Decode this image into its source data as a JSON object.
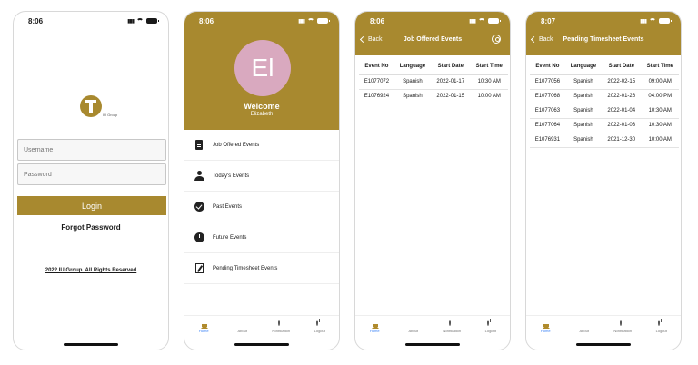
{
  "login_screen": {
    "time": "8:06",
    "logo_sub": "IU Group",
    "username_placeholder": "Username",
    "password_placeholder": "Password",
    "login_label": "Login",
    "forgot_label": "Forgot Password",
    "copyright": "2022 IU Group. All Rights Reserved"
  },
  "home_screen": {
    "time": "8:06",
    "avatar_initials": "El",
    "welcome": "Welcome",
    "user_name": "Elizabeth",
    "menu": [
      {
        "label": "Job Offered Events",
        "icon": "clipboard-icon"
      },
      {
        "label": "Today's Events",
        "icon": "person-icon"
      },
      {
        "label": "Past Events",
        "icon": "check-circle-icon"
      },
      {
        "label": "Future Events",
        "icon": "clock-icon"
      },
      {
        "label": "Pending Timesheet Events",
        "icon": "edit-icon"
      }
    ]
  },
  "tabs": [
    {
      "label": "Home",
      "icon": "home-icon"
    },
    {
      "label": "About",
      "icon": "book-icon"
    },
    {
      "label": "Notification",
      "icon": "chat-icon"
    },
    {
      "label": "Logout",
      "icon": "power-icon"
    }
  ],
  "job_offered_screen": {
    "time": "8:06",
    "back_label": "Back",
    "title": "Job Offered Events",
    "columns": [
      "Event No",
      "Language",
      "Start Date",
      "Start Time"
    ],
    "rows": [
      [
        "E1077072",
        "Spanish",
        "2022-01-17",
        "10:30 AM"
      ],
      [
        "E1076924",
        "Spanish",
        "2022-01-15",
        "10:00 AM"
      ]
    ]
  },
  "pending_timesheet_screen": {
    "time": "8:07",
    "back_label": "Back",
    "title": "Pending Timesheet Events",
    "columns": [
      "Event No",
      "Language",
      "Start Date",
      "Start Time"
    ],
    "rows": [
      [
        "E1077056",
        "Spanish",
        "2022-02-15",
        "09:00 AM"
      ],
      [
        "E1077068",
        "Spanish",
        "2022-01-26",
        "04:00 PM"
      ],
      [
        "E1077063",
        "Spanish",
        "2022-01-04",
        "10:30 AM"
      ],
      [
        "E1077064",
        "Spanish",
        "2022-01-03",
        "10:30 AM"
      ],
      [
        "E1076931",
        "Spanish",
        "2021-12-30",
        "10:00 AM"
      ]
    ]
  },
  "colors": {
    "brand": "#a8892f",
    "avatar": "#d9a9bf",
    "tab_active": "#3b82f6"
  }
}
